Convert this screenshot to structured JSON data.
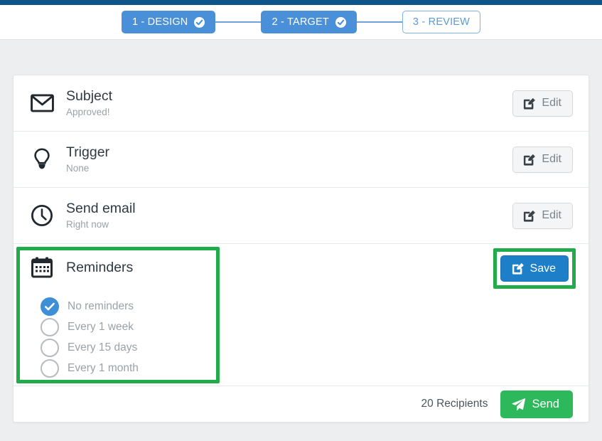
{
  "theme": {
    "topbar_color": "#0e5689",
    "accent_blue": "#4a90d9",
    "button_blue": "#1e7fc9",
    "highlight_green": "#22ab4b",
    "send_green": "#2eb85c",
    "page_background": "#eceeef",
    "muted_text": "#9aa2a8"
  },
  "wizard": {
    "steps": [
      {
        "label": "1 - DESIGN",
        "state": "done",
        "icon": "check-circle-icon"
      },
      {
        "label": "2 - TARGET",
        "state": "done",
        "icon": "check-circle-icon"
      },
      {
        "label": "3 - REVIEW",
        "state": "current",
        "icon": ""
      }
    ]
  },
  "rows": [
    {
      "icon": "envelope-icon",
      "title": "Subject",
      "subtitle": "Approved!",
      "action_label": "Edit",
      "action_icon": "pencil-square-icon"
    },
    {
      "icon": "lightbulb-icon",
      "title": "Trigger",
      "subtitle": "None",
      "action_label": "Edit",
      "action_icon": "pencil-square-icon"
    },
    {
      "icon": "clock-icon",
      "title": "Send email",
      "subtitle": "Right now",
      "action_label": "Edit",
      "action_icon": "pencil-square-icon"
    }
  ],
  "reminders": {
    "icon": "calendar-icon",
    "title": "Reminders",
    "save_label": "Save",
    "save_icon": "pencil-square-icon",
    "options": [
      {
        "label": "No reminders",
        "selected": true
      },
      {
        "label": "Every 1 week",
        "selected": false
      },
      {
        "label": "Every 15 days",
        "selected": false
      },
      {
        "label": "Every 1 month",
        "selected": false
      }
    ]
  },
  "footer": {
    "recipients_text": "20 Recipients",
    "send_label": "Send",
    "send_icon": "paper-plane-icon"
  }
}
